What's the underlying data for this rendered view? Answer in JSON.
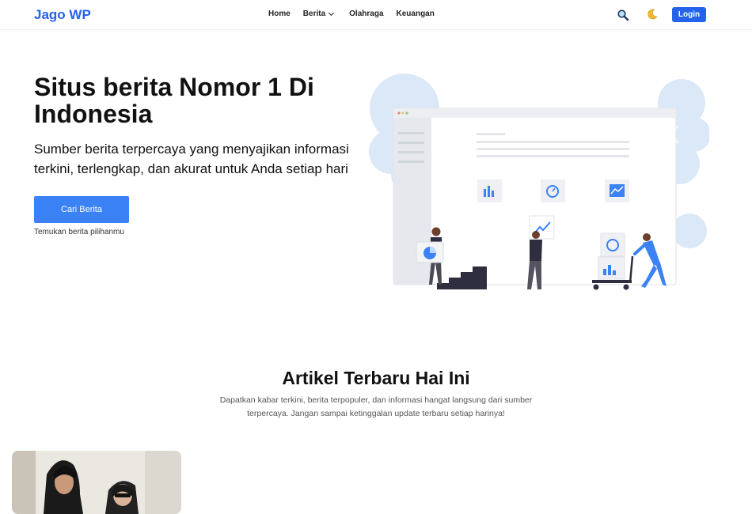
{
  "header": {
    "brand": "Jago WP",
    "nav": [
      "Home",
      "Berita",
      "Olahraga",
      "Keuangan"
    ],
    "login_label": "Login",
    "icons": [
      "search-icon",
      "moon-icon",
      "chevron-down-icon"
    ]
  },
  "hero": {
    "title": "Situs berita Nomor 1 Di Indonesia",
    "subtitle": "Sumber berita terpercaya yang menyajikan informasi terkini, terlengkap, dan akurat untuk Anda setiap hari",
    "cta_label": "Cari Berita",
    "cta_hint": "Temukan berita pilihanmu"
  },
  "section": {
    "title": "Artikel Terbaru Hai Ini",
    "description": "Dapatkan kabar terkini, berita terpopuler, dan informasi hangat langsung dari sumber terpercaya. Jangan sampai ketinggalan update terbaru setiap harinya!"
  },
  "colors": {
    "accent": "#2563eb",
    "button": "#3b82f6",
    "illustration_blue": "#3b82f6",
    "illustration_light": "#dbe8f7"
  }
}
